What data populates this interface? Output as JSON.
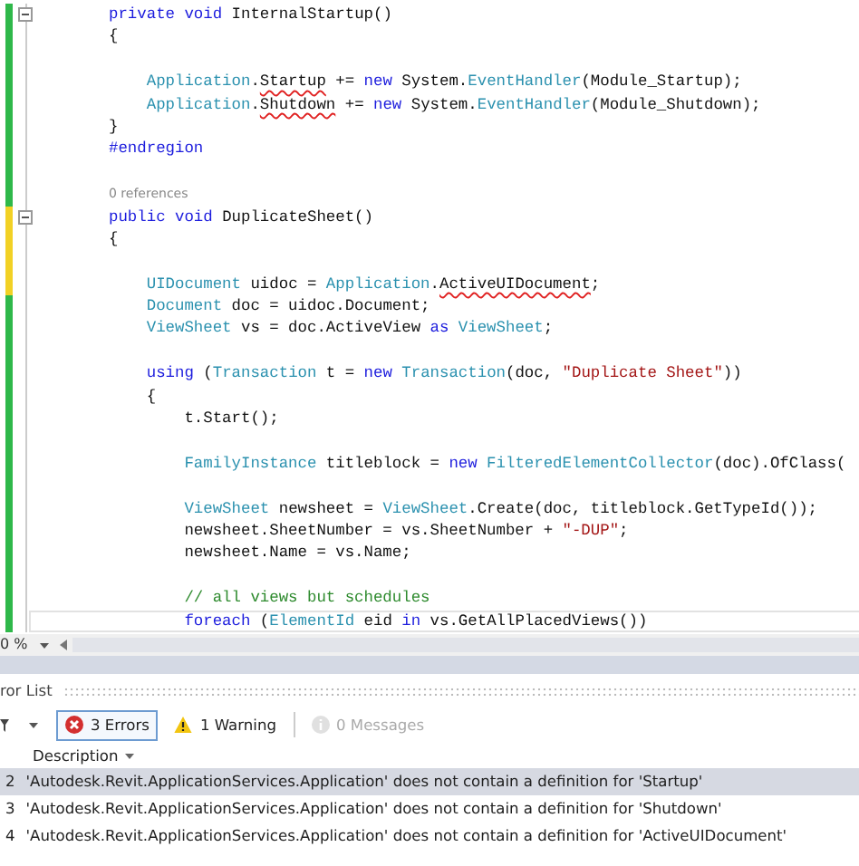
{
  "editor": {
    "lines": [
      {
        "kind": "code",
        "unsaved": false,
        "fold": true,
        "tokens": [
          {
            "text": "private",
            "kind": "keyword"
          },
          {
            "text": " void",
            "kind": "keyword"
          },
          {
            "text": " InternalStartup()",
            "kind": "plain"
          }
        ]
      },
      {
        "kind": "code",
        "unsaved": false,
        "tokens": [
          {
            "text": "{",
            "kind": "plain"
          }
        ]
      },
      {
        "kind": "blank",
        "unsaved": false
      },
      {
        "kind": "code",
        "unsaved": false,
        "tokens": [
          {
            "text": "    Application",
            "kind": "type"
          },
          {
            "text": ".",
            "kind": "plain"
          },
          {
            "text": "Startup",
            "kind": "error"
          },
          {
            "text": " += ",
            "kind": "plain"
          },
          {
            "text": "new",
            "kind": "keyword"
          },
          {
            "text": " System.",
            "kind": "plain"
          },
          {
            "text": "EventHandler",
            "kind": "type"
          },
          {
            "text": "(Module_Startup);",
            "kind": "plain"
          }
        ]
      },
      {
        "kind": "code",
        "unsaved": false,
        "tokens": [
          {
            "text": "    Application",
            "kind": "type"
          },
          {
            "text": ".",
            "kind": "plain"
          },
          {
            "text": "Shutdown",
            "kind": "error"
          },
          {
            "text": " += ",
            "kind": "plain"
          },
          {
            "text": "new",
            "kind": "keyword"
          },
          {
            "text": " System.",
            "kind": "plain"
          },
          {
            "text": "EventHandler",
            "kind": "type"
          },
          {
            "text": "(Module_Shutdown);",
            "kind": "plain"
          }
        ]
      },
      {
        "kind": "code",
        "unsaved": false,
        "tokens": [
          {
            "text": "}",
            "kind": "plain"
          }
        ]
      },
      {
        "kind": "code",
        "unsaved": false,
        "tokens": [
          {
            "text": "#endregion",
            "kind": "keyword"
          }
        ]
      },
      {
        "kind": "blank",
        "unsaved": false
      },
      {
        "kind": "lens",
        "unsaved": false,
        "text": "0 references"
      },
      {
        "kind": "code",
        "unsaved": true,
        "fold": true,
        "tokens": [
          {
            "text": "public",
            "kind": "keyword"
          },
          {
            "text": " void",
            "kind": "keyword"
          },
          {
            "text": " DuplicateSheet()",
            "kind": "plain"
          }
        ]
      },
      {
        "kind": "code",
        "unsaved": true,
        "tokens": [
          {
            "text": "{",
            "kind": "plain"
          }
        ]
      },
      {
        "kind": "blank",
        "unsaved": true
      },
      {
        "kind": "code",
        "unsaved": true,
        "tokens": [
          {
            "text": "    UIDocument",
            "kind": "type"
          },
          {
            "text": " uidoc = ",
            "kind": "plain"
          },
          {
            "text": "Application",
            "kind": "type"
          },
          {
            "text": ".",
            "kind": "plain"
          },
          {
            "text": "ActiveUIDocument",
            "kind": "error"
          },
          {
            "text": ";",
            "kind": "plain"
          }
        ]
      },
      {
        "kind": "code",
        "unsaved": false,
        "tokens": [
          {
            "text": "    Document",
            "kind": "type"
          },
          {
            "text": " doc = uidoc.Document;",
            "kind": "plain"
          }
        ]
      },
      {
        "kind": "code",
        "unsaved": false,
        "tokens": [
          {
            "text": "    ViewSheet",
            "kind": "type"
          },
          {
            "text": " vs = doc.ActiveView ",
            "kind": "plain"
          },
          {
            "text": "as",
            "kind": "keyword"
          },
          {
            "text": " ViewSheet",
            "kind": "type"
          },
          {
            "text": ";",
            "kind": "plain"
          }
        ]
      },
      {
        "kind": "blank",
        "unsaved": false
      },
      {
        "kind": "code",
        "unsaved": false,
        "tokens": [
          {
            "text": "    using",
            "kind": "keyword"
          },
          {
            "text": " (",
            "kind": "plain"
          },
          {
            "text": "Transaction",
            "kind": "type"
          },
          {
            "text": " t = ",
            "kind": "plain"
          },
          {
            "text": "new",
            "kind": "keyword"
          },
          {
            "text": " Transaction",
            "kind": "type"
          },
          {
            "text": "(doc, ",
            "kind": "plain"
          },
          {
            "text": "\"Duplicate Sheet\"",
            "kind": "string"
          },
          {
            "text": "))",
            "kind": "plain"
          }
        ]
      },
      {
        "kind": "code",
        "unsaved": false,
        "tokens": [
          {
            "text": "    {",
            "kind": "plain"
          }
        ]
      },
      {
        "kind": "code",
        "unsaved": false,
        "tokens": [
          {
            "text": "        t.Start();",
            "kind": "plain"
          }
        ]
      },
      {
        "kind": "blank",
        "unsaved": false
      },
      {
        "kind": "code",
        "unsaved": false,
        "tokens": [
          {
            "text": "        FamilyInstance",
            "kind": "type"
          },
          {
            "text": " titleblock = ",
            "kind": "plain"
          },
          {
            "text": "new",
            "kind": "keyword"
          },
          {
            "text": " FilteredElementCollector",
            "kind": "type"
          },
          {
            "text": "(doc).OfClass(",
            "kind": "plain"
          }
        ]
      },
      {
        "kind": "blank",
        "unsaved": false
      },
      {
        "kind": "code",
        "unsaved": false,
        "tokens": [
          {
            "text": "        ViewSheet",
            "kind": "type"
          },
          {
            "text": " newsheet = ",
            "kind": "plain"
          },
          {
            "text": "ViewSheet",
            "kind": "type"
          },
          {
            "text": ".Create(doc, titleblock.GetTypeId());",
            "kind": "plain"
          }
        ]
      },
      {
        "kind": "code",
        "unsaved": false,
        "tokens": [
          {
            "text": "        newsheet.SheetNumber = vs.SheetNumber + ",
            "kind": "plain"
          },
          {
            "text": "\"-DUP\"",
            "kind": "string"
          },
          {
            "text": ";",
            "kind": "plain"
          }
        ]
      },
      {
        "kind": "code",
        "unsaved": false,
        "tokens": [
          {
            "text": "        newsheet.Name = vs.Name;",
            "kind": "plain"
          }
        ]
      },
      {
        "kind": "blank",
        "unsaved": false
      },
      {
        "kind": "code",
        "unsaved": false,
        "tokens": [
          {
            "text": "        // all views but schedules",
            "kind": "comment"
          }
        ]
      },
      {
        "kind": "code",
        "unsaved": false,
        "current": true,
        "tokens": [
          {
            "text": "        foreach",
            "kind": "keyword"
          },
          {
            "text": " (",
            "kind": "plain"
          },
          {
            "text": "ElementId",
            "kind": "type"
          },
          {
            "text": " eid ",
            "kind": "plain"
          },
          {
            "text": "in",
            "kind": "keyword"
          },
          {
            "text": " vs.GetAllPlacedViews())",
            "kind": "plain"
          }
        ]
      }
    ]
  },
  "zoom_bar": {
    "zoom": "0 %"
  },
  "error_list": {
    "title": "ror List",
    "filters": [
      {
        "kind": "error",
        "label": "3 Errors",
        "selected": true,
        "disabled": false
      },
      {
        "kind": "warning",
        "label": "1 Warning",
        "selected": false,
        "disabled": false
      },
      {
        "kind": "message",
        "label": "0 Messages",
        "selected": false,
        "disabled": true
      }
    ],
    "columns": [
      "Description"
    ],
    "rows": [
      {
        "number": "2",
        "description": "'Autodesk.Revit.ApplicationServices.Application' does not contain a definition for 'Startup'",
        "selected": true
      },
      {
        "number": "3",
        "description": "'Autodesk.Revit.ApplicationServices.Application' does not contain a definition for 'Shutdown'",
        "selected": false
      },
      {
        "number": "4",
        "description": "'Autodesk.Revit.ApplicationServices.Application' does not contain a definition for 'ActiveUIDocument'",
        "selected": false
      }
    ]
  }
}
